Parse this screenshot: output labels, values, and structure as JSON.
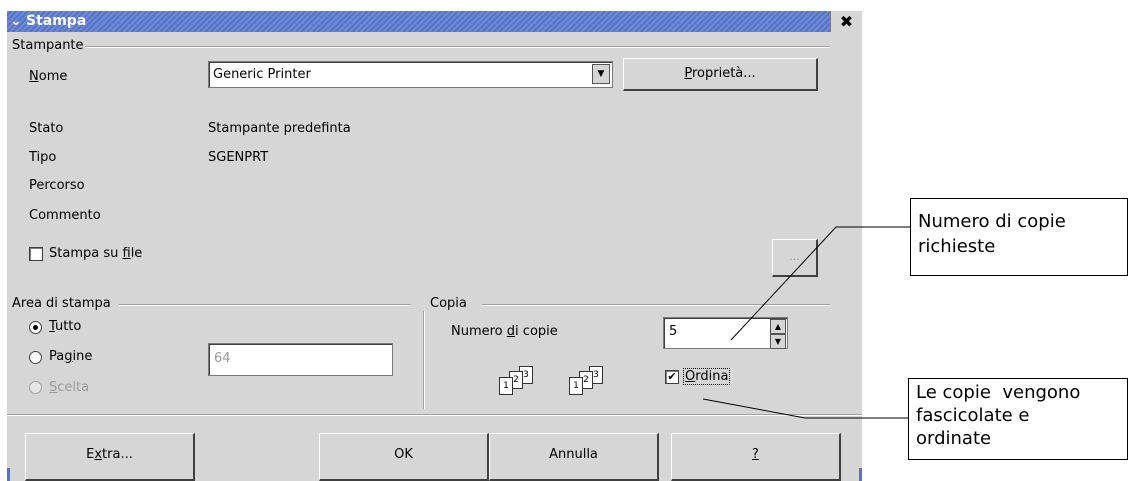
{
  "window": {
    "title": "Stampa",
    "close_glyph": "✖",
    "menu_glyph": "⌄"
  },
  "printer": {
    "group_label": "Stampante",
    "name_label_first": "N",
    "name_label_rest": "ome",
    "name_value": "Generic Printer",
    "properties_first": "P",
    "properties_rest": "roprietà...",
    "status_label": "Stato",
    "status_value": "Stampante predefinta",
    "type_label": "Tipo",
    "type_value": "SGENPRT",
    "location_label": "Percorso",
    "comment_label": "Commento",
    "print_to_file_pre": "Stampa su ",
    "print_to_file_accel": "f",
    "print_to_file_post": "ile",
    "print_to_file_checked": false,
    "browse_label": "..."
  },
  "area": {
    "group_label": "Area di stampa",
    "all_accel": "T",
    "all_rest": "utto",
    "pages_pre": "Pa",
    "pages_accel": "g",
    "pages_post": "ine",
    "pages_value": "64",
    "selection_accel": "S",
    "selection_rest": "celta",
    "selected": "all"
  },
  "copies": {
    "group_label": "Copia",
    "count_label_pre": "Numero ",
    "count_label_accel": "d",
    "count_label_post": "i copie",
    "count_value": "5",
    "collate_label": "Ordina",
    "collate_accel": "O",
    "collate_rest": "rdina",
    "collate_checked": true,
    "page_numbers": [
      "1",
      "2",
      "3"
    ]
  },
  "buttons": {
    "extra_pre": "E",
    "extra_accel": "x",
    "extra_post": "tra...",
    "ok": "OK",
    "cancel": "Annulla",
    "help": "?"
  },
  "annotations": {
    "copies_note_line1": "Numero di copie",
    "copies_note_line2": "richieste",
    "collate_note_line1": "Le copie  vengono",
    "collate_note_line2": "fascicolate e",
    "collate_note_line3": "ordinate"
  }
}
